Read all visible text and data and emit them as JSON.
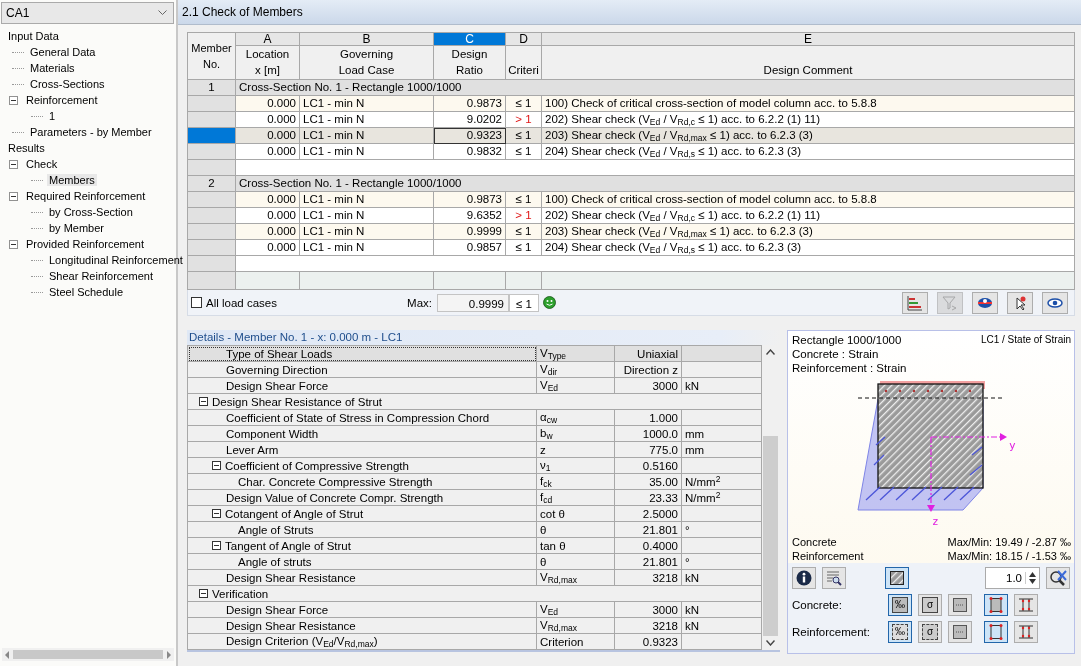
{
  "selector": {
    "value": "CA1"
  },
  "tree": [
    {
      "label": "Input Data",
      "selected": false,
      "children": [
        {
          "label": "General Data",
          "selected": false
        },
        {
          "label": "Materials",
          "selected": false
        },
        {
          "label": "Cross-Sections",
          "selected": false
        },
        {
          "label": "Reinforcement",
          "expanded": true,
          "selected": false,
          "children": [
            {
              "label": "1",
              "selected": false
            }
          ]
        },
        {
          "label": "Parameters - by Member",
          "selected": false
        }
      ]
    },
    {
      "label": "Results",
      "selected": false,
      "children": [
        {
          "label": "Check",
          "expanded": true,
          "selected": false,
          "children": [
            {
              "label": "Members",
              "selected": true
            }
          ]
        },
        {
          "label": "Required Reinforcement",
          "expanded": true,
          "selected": false,
          "children": [
            {
              "label": "by Cross-Section",
              "selected": false
            },
            {
              "label": "by Member",
              "selected": false
            }
          ]
        },
        {
          "label": "Provided Reinforcement",
          "expanded": true,
          "selected": false,
          "children": [
            {
              "label": "Longitudinal Reinforcement",
              "selected": false
            },
            {
              "label": "Shear Reinforcement",
              "selected": false
            },
            {
              "label": "Steel Schedule",
              "selected": false
            }
          ]
        }
      ]
    }
  ],
  "title": "2.1 Check of Members",
  "table": {
    "corner": [
      "Member",
      "No."
    ],
    "columns": [
      {
        "letter": "A",
        "heading": [
          "Location",
          "x [m]"
        ],
        "selected": false
      },
      {
        "letter": "B",
        "heading": [
          "Governing",
          "Load Case"
        ],
        "selected": false
      },
      {
        "letter": "C",
        "heading": [
          "Design",
          "Ratio"
        ],
        "selected": true
      },
      {
        "letter": "D",
        "heading": [
          "Criteri"
        ],
        "selected": false
      },
      {
        "letter": "E",
        "heading": [
          "Design Comment"
        ],
        "selected": false
      }
    ],
    "members": [
      {
        "number": "1",
        "title": "Cross-Section No. 1 - Rectangle 1000/1000",
        "rows": [
          {
            "location": "0.000",
            "load_case": "LC1 - min N",
            "ratio": "0.9873",
            "criterion": "≤ 1",
            "exceeded": false,
            "comment": "100) Check of critical cross-section of model column acc. to 5.8.8",
            "selected": false
          },
          {
            "location": "0.000",
            "load_case": "LC1 - min N",
            "ratio": "9.0202",
            "criterion": "> 1",
            "exceeded": true,
            "comment": "202) Shear check (V$_{Ed}$ / V$_{Rd,c}$ ≤ 1) acc. to 6.2.2 (1) 11)",
            "selected": false
          },
          {
            "location": "0.000",
            "load_case": "LC1 - min N",
            "ratio": "0.9323",
            "criterion": "≤ 1",
            "exceeded": false,
            "comment": "203) Shear check  (V$_{Ed}$ / V$_{Rd,max}$ ≤ 1) acc. to 6.2.3 (3)",
            "selected": true
          },
          {
            "location": "0.000",
            "load_case": "LC1 - min N",
            "ratio": "0.9832",
            "criterion": "≤ 1",
            "exceeded": false,
            "comment": "204) Shear check (V$_{Ed}$ / V$_{Rd,s}$ ≤ 1) acc. to 6.2.3 (3)",
            "selected": false
          }
        ]
      },
      {
        "number": "2",
        "title": "Cross-Section No. 1 - Rectangle 1000/1000",
        "rows": [
          {
            "location": "0.000",
            "load_case": "LC1 - min N",
            "ratio": "0.9873",
            "criterion": "≤ 1",
            "exceeded": false,
            "comment": "100) Check of critical cross-section of model column acc. to 5.8.8",
            "selected": false
          },
          {
            "location": "0.000",
            "load_case": "LC1 - min N",
            "ratio": "9.6352",
            "criterion": "> 1",
            "exceeded": true,
            "comment": "202) Shear check (V$_{Ed}$ / V$_{Rd,c}$ ≤ 1) acc. to 6.2.2 (1) 11)",
            "selected": false
          },
          {
            "location": "0.000",
            "load_case": "LC1 - min N",
            "ratio": "0.9999",
            "criterion": "≤ 1",
            "exceeded": false,
            "comment": "203) Shear check  (V$_{Ed}$ / V$_{Rd,max}$ ≤ 1) acc. to 6.2.3 (3)",
            "selected": false
          },
          {
            "location": "0.000",
            "load_case": "LC1 - min N",
            "ratio": "0.9857",
            "criterion": "≤ 1",
            "exceeded": false,
            "comment": "204) Shear check (V$_{Ed}$ / V$_{Rd,s}$ ≤ 1) acc. to 6.2.3 (3)",
            "selected": false
          }
        ]
      }
    ]
  },
  "all_load_cases": {
    "label": "All load cases",
    "checked": false
  },
  "max": {
    "label": "Max:",
    "value": "0.9999",
    "criterion": "≤ 1",
    "ok": true
  },
  "table_tools": [
    {
      "kind": "bars",
      "disabled": false
    },
    {
      "kind": "filter",
      "disabled": true
    },
    {
      "kind": "colors",
      "disabled": false
    },
    {
      "kind": "pick",
      "disabled": false
    },
    {
      "kind": "view",
      "disabled": false
    }
  ],
  "details": {
    "title": "Details  -  Member No. 1  -  x: 0.000 m  -  LC1",
    "rows": [
      {
        "label": "Type of Shear Loads",
        "symbol": "V$_{Type}$",
        "value": "Uniaxial",
        "selected": true
      },
      {
        "label": "Governing Direction",
        "symbol": "V$_{dir}$",
        "value": "Direction z",
        "selected": false
      },
      {
        "label": "Design Shear Force",
        "symbol": "V$_{Ed}$",
        "value": "3000",
        "unit": "kN",
        "selected": false
      },
      {
        "label": "Design Shear Resistance of Strut",
        "expanded": true,
        "selected": false,
        "children": [
          {
            "label": "Coefficient of State of Stress in Compression Chord",
            "symbol": "α$_{cw}$",
            "value": "1.000",
            "selected": false
          },
          {
            "label": "Component Width",
            "symbol": "b$_{w}$",
            "value": "1000.0",
            "unit": "mm",
            "selected": false
          },
          {
            "label": "Lever Arm",
            "symbol": "z",
            "value": "775.0",
            "unit": "mm",
            "selected": false
          },
          {
            "label": "Coefficient of Compressive Strength",
            "symbol": "ν$_{1}$",
            "value": "0.5160",
            "expanded": true,
            "selected": false,
            "children": [
              {
                "label": "Char. Concrete Compressive Strength",
                "symbol": "f$_{ck}$",
                "value": "35.00",
                "unit": "N/mm$^{2}$",
                "selected": false
              }
            ]
          },
          {
            "label": "Design Value of Concrete Compr. Strength",
            "symbol": "f$_{cd}$",
            "value": "23.33",
            "unit": "N/mm$^{2}$",
            "selected": false
          },
          {
            "label": "Cotangent of Angle of Strut",
            "symbol": "cot θ",
            "value": "2.5000",
            "expanded": true,
            "selected": false,
            "children": [
              {
                "label": "Angle of Struts",
                "symbol": "θ",
                "value": "21.801",
                "unit": "°",
                "selected": false
              }
            ]
          },
          {
            "label": "Tangent of Angle of Strut",
            "symbol": "tan θ",
            "value": "0.4000",
            "expanded": true,
            "selected": false,
            "children": [
              {
                "label": "Angle of struts",
                "symbol": "θ",
                "value": "21.801",
                "unit": "°",
                "selected": false
              }
            ]
          },
          {
            "label": "Design Shear Resistance",
            "symbol": "V$_{Rd,max}$",
            "value": "3218",
            "unit": "kN",
            "selected": false
          }
        ]
      },
      {
        "label": "Verification",
        "expanded": true,
        "selected": false,
        "children": [
          {
            "label": "Design Shear Force",
            "symbol": "V$_{Ed}$",
            "value": "3000",
            "unit": "kN",
            "selected": false
          },
          {
            "label": "Design Shear Resistance",
            "symbol": "V$_{Rd,max}$",
            "value": "3218",
            "unit": "kN",
            "selected": false
          },
          {
            "label": "Design Criterion (V$_{Ed}$/V$_{Rd,max}$)",
            "symbol": "Criterion",
            "value": "0.9323",
            "selected": false
          }
        ]
      }
    ]
  },
  "graphic": {
    "lines": [
      "Rectangle 1000/1000",
      "Concrete : Strain",
      "Reinforcement : Strain"
    ],
    "caption": "LC1 / State of Strain",
    "axes": {
      "y": "y",
      "z": "z"
    },
    "results": [
      {
        "label": "Concrete",
        "value": "Max/Min: 19.49 / -2.87 ‰"
      },
      {
        "label": "Reinforcement",
        "value": "Max/Min: 18.15 / -1.53 ‰"
      }
    ],
    "hatch": {
      "selected": true
    },
    "scale": "1.0",
    "groups": [
      {
        "label": "Concrete:",
        "buttons": [
          {
            "kind": "strain",
            "glyph": "‰",
            "selected": true
          },
          {
            "kind": "stress",
            "glyph": "σ",
            "selected": false
          },
          {
            "kind": "legend",
            "selected": false
          },
          {
            "kind": "frame",
            "selected": true
          },
          {
            "kind": "dimensions",
            "selected": false
          }
        ]
      },
      {
        "label": "Reinforcement:",
        "buttons": [
          {
            "kind": "strain",
            "glyph": "‰",
            "selected": true
          },
          {
            "kind": "stress",
            "glyph": "σ",
            "selected": false
          },
          {
            "kind": "legend",
            "selected": false
          },
          {
            "kind": "frame",
            "selected": true
          },
          {
            "kind": "dimensions",
            "selected": false
          }
        ]
      }
    ]
  }
}
